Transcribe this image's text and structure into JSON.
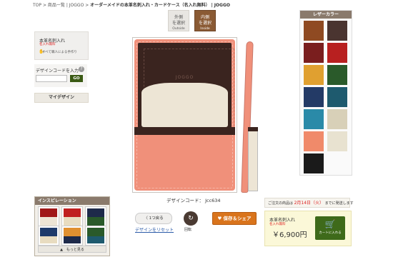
{
  "breadcrumb": {
    "home": "TOP",
    "sep1": ">",
    "list": "商品一覧",
    "sep_bar": "|",
    "brand": "JOGGO",
    "sep2": ">",
    "current": "オーダーメイドの本革名刺入れ・カードケース（名入れ無料）",
    "sep3": "|",
    "brand2": "JOGGO"
  },
  "left": {
    "name_engraving": "本革名刺入れ",
    "free_engraving": "名入れ無料",
    "handmade": "すべて職人による手作り",
    "design_code_label": "デザインコードを入力",
    "help": "?",
    "code_placeholder": "",
    "go": "GO",
    "my_design": "マイデザイン"
  },
  "inspiration": {
    "title": "インスピレーション",
    "more": "▲　もっと見る"
  },
  "view_toggle": {
    "outside_label": "外側",
    "outside_sub": "を選択",
    "outside_en": "Outside",
    "inside_label": "内側",
    "inside_sub": "を選択",
    "inside_en": "Inside"
  },
  "product": {
    "logo": "JOGGO",
    "design_code_label": "デザインコード：",
    "design_code": "Jcc634"
  },
  "actions": {
    "back": "〈 1つ戻る",
    "reset": "デザインをリセット",
    "rotate_label": "回転",
    "save_share": "♥ 保存＆シェア"
  },
  "palette": {
    "title": "レザーカラー",
    "colors": [
      "#8f4a22",
      "#4a3430",
      "#7a1e1e",
      "#b82020",
      "#e0a030",
      "#2a5a2a",
      "#233a66",
      "#1e5a6e",
      "#2a8aa8",
      "#d8d0b8",
      "#f08a6a",
      "#e8e2d0",
      "#1a1a1a"
    ]
  },
  "price": {
    "ship_prefix": "ご注文の商品は",
    "ship_date": "2月14日（火）",
    "ship_suffix": "までに発送します",
    "item": "本革名刺入れ",
    "free": "名入れ無料",
    "price": "￥6,900円",
    "cart": "カートに入れる",
    "cart_icon": "cart-icon"
  }
}
